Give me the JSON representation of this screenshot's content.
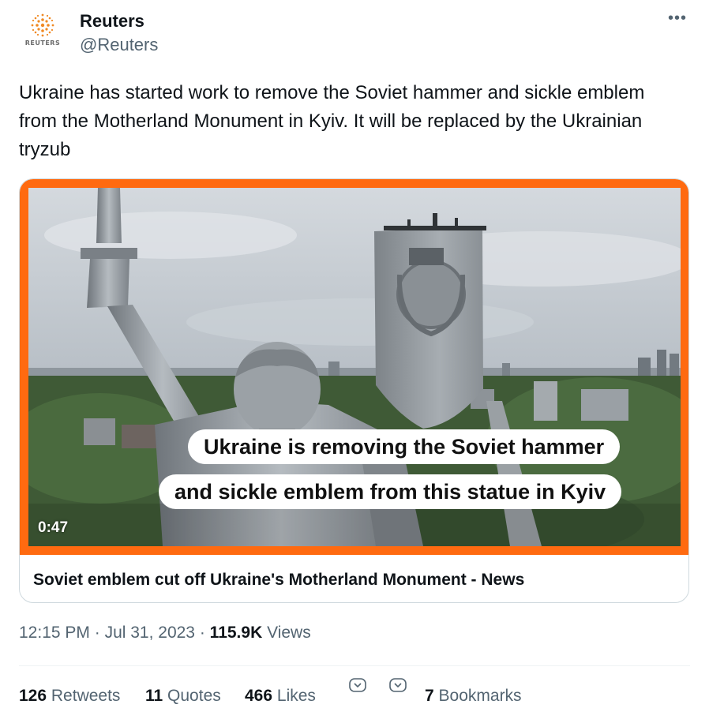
{
  "account": {
    "name": "Reuters",
    "handle": "@Reuters",
    "avatar_label": "REUTERS"
  },
  "tweet": {
    "text": "Ukraine has started work to remove the Soviet hammer and sickle emblem from the Motherland Monument in Kyiv. It will be replaced by the Ukrainian tryzub"
  },
  "media": {
    "caption_line1": "Ukraine is removing the Soviet hammer",
    "caption_line2": "and sickle emblem from this statue in Kyiv",
    "duration": "0:47",
    "card_title": "Soviet emblem cut off Ukraine's Motherland Monument - News"
  },
  "meta": {
    "time": "12:15 PM",
    "date": "Jul 31, 2023",
    "views_count": "115.9K",
    "views_label": "Views"
  },
  "stats": {
    "retweets_count": "126",
    "retweets_label": "Retweets",
    "quotes_count": "11",
    "quotes_label": "Quotes",
    "likes_count": "466",
    "likes_label": "Likes",
    "bookmarks_count": "7",
    "bookmarks_label": "Bookmarks"
  },
  "colors": {
    "accent_orange": "#ff6a10",
    "text_primary": "#0f1419",
    "text_secondary": "#536471"
  }
}
